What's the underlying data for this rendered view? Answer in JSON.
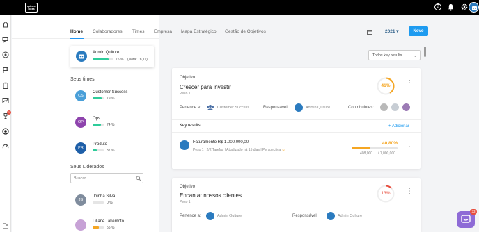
{
  "topbar": {
    "logo_text": "qulture rocks",
    "icons": [
      "help-icon",
      "bell-icon",
      "gear-icon"
    ]
  },
  "sidebar": {
    "icons": [
      "home-icon",
      "chat-icon",
      "target-icon",
      "flag-icon",
      "clipboard-icon",
      "chart-icon",
      "trophy-icon",
      "objective-icon",
      "speed-icon",
      "building-icon"
    ],
    "badge": "1"
  },
  "tabs": [
    "Home",
    "Colaboradores",
    "Times",
    "Empresa",
    "Mapa Estratégico",
    "Gestão de Objetivos"
  ],
  "user_card": {
    "name": "Admin Qulture",
    "progress": 75,
    "pct_label": "75 %",
    "note": "(Nota: 78,11)",
    "bar_color": "#2ecc9a"
  },
  "teams": {
    "title": "Seus times",
    "items": [
      {
        "initials": "CS",
        "name": "Customer Success",
        "pct": "79 %",
        "progress": 79,
        "color": "#4a9fd8"
      },
      {
        "initials": "OP",
        "name": "Ops",
        "pct": "74 %",
        "progress": 74,
        "color": "#8e44ad"
      },
      {
        "initials": "PR",
        "name": "Produto",
        "pct": "37 %",
        "progress": 37,
        "color": "#1e5fa8"
      }
    ]
  },
  "led": {
    "title": "Seus Liderados",
    "search_placeholder": "Buscar",
    "items": [
      {
        "initials": "JS",
        "name": "Joinha Silva",
        "pct": "0 %",
        "progress": 0,
        "color": "#7f8c9d"
      },
      {
        "name": "Liliane Takemoto",
        "pct": "55 %",
        "progress": 55,
        "color": "#c7a2d6"
      }
    ]
  },
  "toolbar": {
    "year": "2021",
    "new_label": "Novo",
    "filter_label": "Todos key results"
  },
  "objectives": [
    {
      "label": "Objetivo",
      "title": "Crescer para investir",
      "weight": "Peso 1",
      "progress": 41,
      "progress_label": "41%",
      "ring_color": "#f5a623",
      "belongs_label": "Pertence a:",
      "belongs_value": "Customer Success",
      "resp_label": "Responsável:",
      "resp_value": "Admin Qulture",
      "contrib_label": "Contribuintes:",
      "kr_header": "Key results",
      "add_kr": "+ Adicionar",
      "key_results": [
        {
          "title": "Faturamento R$ 1.000.000,00",
          "meta": [
            "Peso 1",
            "2/2 Tarefas",
            "Atualizado há 15 dias",
            "Perspectiva"
          ],
          "pct_label": "40,80%",
          "progress": 40.8,
          "current": "408,000",
          "target": "/ 1,000,000",
          "color": "#f5a623"
        }
      ]
    },
    {
      "label": "Objetivo",
      "title": "Encantar nossos clientes",
      "weight": "Peso 1",
      "progress": 13,
      "progress_label": "13%",
      "ring_color": "#e74c3c",
      "belongs_label": "Pertence a:",
      "belongs_value": "Admin Qulture",
      "resp_label": "Responsável:",
      "resp_value": "Admin Qulture"
    }
  ],
  "chat": {
    "badge": "33"
  }
}
